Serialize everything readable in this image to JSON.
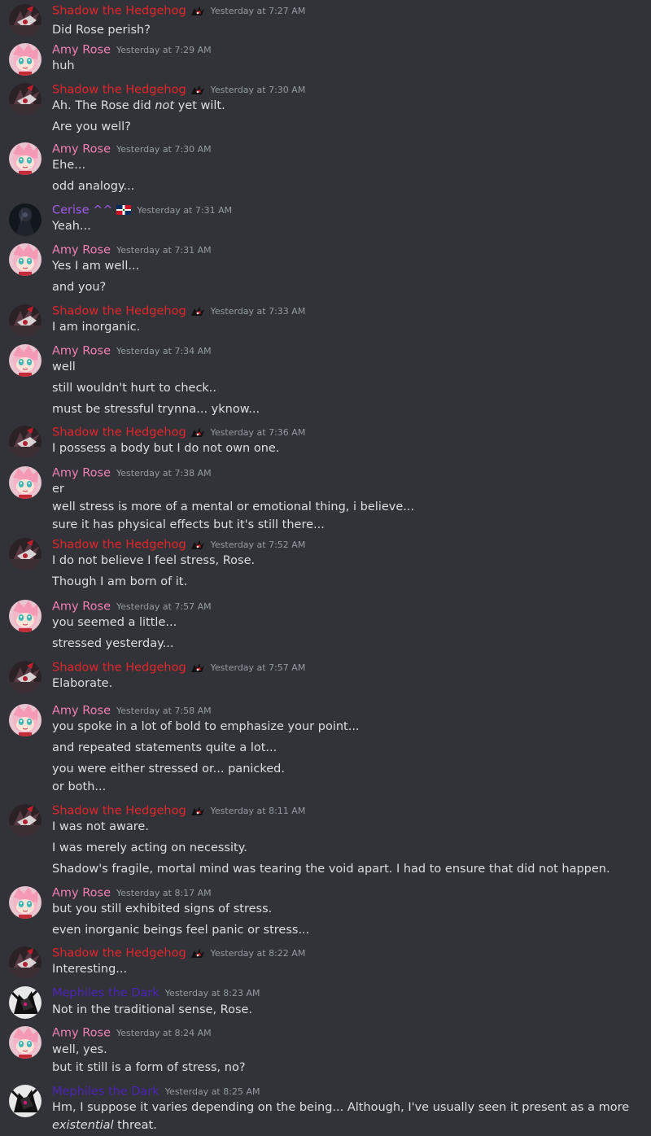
{
  "colors": {
    "background": "#313338",
    "text": "#dbdee1",
    "timestamp": "#949ba4",
    "shadow_name": "#e5252a",
    "amy_name": "#f47fb5",
    "cerise_name": "#a35ce8",
    "mephiles_name": "#4b23b8"
  },
  "users": {
    "shadow": {
      "name": "Shadow the Hedgehog",
      "badge_icon": "shadow-badge-icon"
    },
    "amy": {
      "name": "Amy Rose"
    },
    "cerise": {
      "name": "Cerise ^^",
      "badge_icon": "dominican-flag-icon"
    },
    "mephiles": {
      "name": "Mephiles the Dark"
    }
  },
  "messages": [
    {
      "author": "shadow",
      "timestamp": "Yesterday at 7:27 AM",
      "lines": [
        "Did Rose perish?"
      ]
    },
    {
      "author": "amy",
      "timestamp": "Yesterday at 7:29 AM",
      "lines": [
        "huh"
      ]
    },
    {
      "author": "shadow",
      "timestamp": "Yesterday at 7:30 AM",
      "lines": [
        {
          "before": "Ah. The Rose did ",
          "emph": "not",
          "after": " yet wilt."
        },
        "Are you well?"
      ]
    },
    {
      "author": "amy",
      "timestamp": "Yesterday at 7:30 AM",
      "lines": [
        "Ehe...",
        "odd analogy..."
      ]
    },
    {
      "author": "cerise",
      "timestamp": "Yesterday at 7:31 AM",
      "lines": [
        "Yeah..."
      ]
    },
    {
      "author": "amy",
      "timestamp": "Yesterday at 7:31 AM",
      "lines": [
        "Yes I am well...",
        "and you?"
      ]
    },
    {
      "author": "shadow",
      "timestamp": "Yesterday at 7:33 AM",
      "lines": [
        "I am inorganic."
      ]
    },
    {
      "author": "amy",
      "timestamp": "Yesterday at 7:34 AM",
      "lines": [
        "well",
        "still wouldn't hurt to check..",
        "must be stressful trynna... yknow..."
      ]
    },
    {
      "author": "shadow",
      "timestamp": "Yesterday at 7:36 AM",
      "lines": [
        "I possess a body but I do not own one."
      ]
    },
    {
      "author": "amy",
      "timestamp": "Yesterday at 7:38 AM",
      "lines": [
        "er",
        "well stress is more of a mental or emotional thing, i believe...",
        "sure it has physical effects but it's still there..."
      ]
    },
    {
      "author": "shadow",
      "timestamp": "Yesterday at 7:52 AM",
      "lines": [
        "I do not believe I feel stress, Rose.",
        "Though I am born of it."
      ]
    },
    {
      "author": "amy",
      "timestamp": "Yesterday at 7:57 AM",
      "lines": [
        "you seemed a little...",
        "stressed yesterday..."
      ]
    },
    {
      "author": "shadow",
      "timestamp": "Yesterday at 7:57 AM",
      "lines": [
        "Elaborate."
      ]
    },
    {
      "author": "amy",
      "timestamp": "Yesterday at 7:58 AM",
      "lines": [
        "you spoke in a lot of bold to emphasize your point...",
        "and repeated statements quite a lot...",
        "you were either stressed or... panicked.",
        "or both..."
      ]
    },
    {
      "author": "shadow",
      "timestamp": "Yesterday at 8:11 AM",
      "lines": [
        "I was not aware.",
        "I was merely acting on necessity.",
        "Shadow's fragile, mortal mind was tearing the void apart. I had to ensure that did not happen."
      ]
    },
    {
      "author": "amy",
      "timestamp": "Yesterday at 8:17 AM",
      "lines": [
        "but you still exhibited signs of stress.",
        "even inorganic beings feel panic or stress..."
      ]
    },
    {
      "author": "shadow",
      "timestamp": "Yesterday at 8:22 AM",
      "lines": [
        "Interesting..."
      ]
    },
    {
      "author": "mephiles",
      "timestamp": "Yesterday at 8:23 AM",
      "lines": [
        "Not in the traditional sense, Rose."
      ]
    },
    {
      "author": "amy",
      "timestamp": "Yesterday at 8:24 AM",
      "lines": [
        "well, yes.",
        "but it still is a form of stress, no?"
      ]
    },
    {
      "author": "mephiles",
      "timestamp": "Yesterday at 8:25 AM",
      "lines": [
        "Hm, I suppose it varies depending on the being... Although, I've usually seen it present as a more",
        {
          "before": "",
          "emph": "existential",
          "after": " threat."
        }
      ]
    }
  ]
}
